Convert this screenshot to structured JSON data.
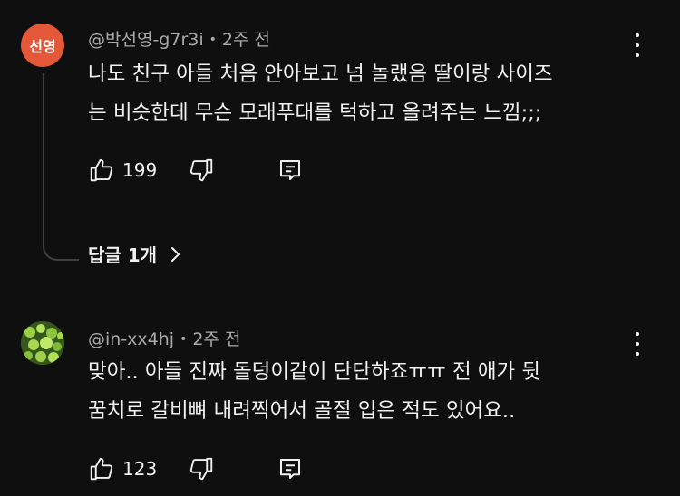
{
  "comments": [
    {
      "avatar_text": "선영",
      "avatar_color": "#e4583a",
      "author": "@박선영-g7r3i",
      "time": "2주 전",
      "text_lines": [
        "나도 친구 아들 처음 안아보고 넘 놀랬음 딸이랑 사이즈",
        "는 비슷한데 무슨 모래푸대를 턱하고 올려주는 느낌;;;"
      ],
      "likes": "199",
      "replies_label": "답글 1개"
    },
    {
      "avatar_icon": "green-plant-avatar",
      "author": "@in-xx4hj",
      "time": "2주 전",
      "text_lines": [
        "맞아.. 아들 진짜 돌덩이같이 단단하죠ㅠㅠ 전 애가 뒷",
        "꿈치로 갈비뼈 내려찍어서 골절 입은 적도 있어요.."
      ],
      "likes": "123"
    }
  ],
  "icons": {
    "like": "thumbs-up-icon",
    "dislike": "thumbs-down-icon",
    "reply": "reply-icon",
    "more": "more-vert-icon",
    "chevron": "chevron-right-icon"
  }
}
